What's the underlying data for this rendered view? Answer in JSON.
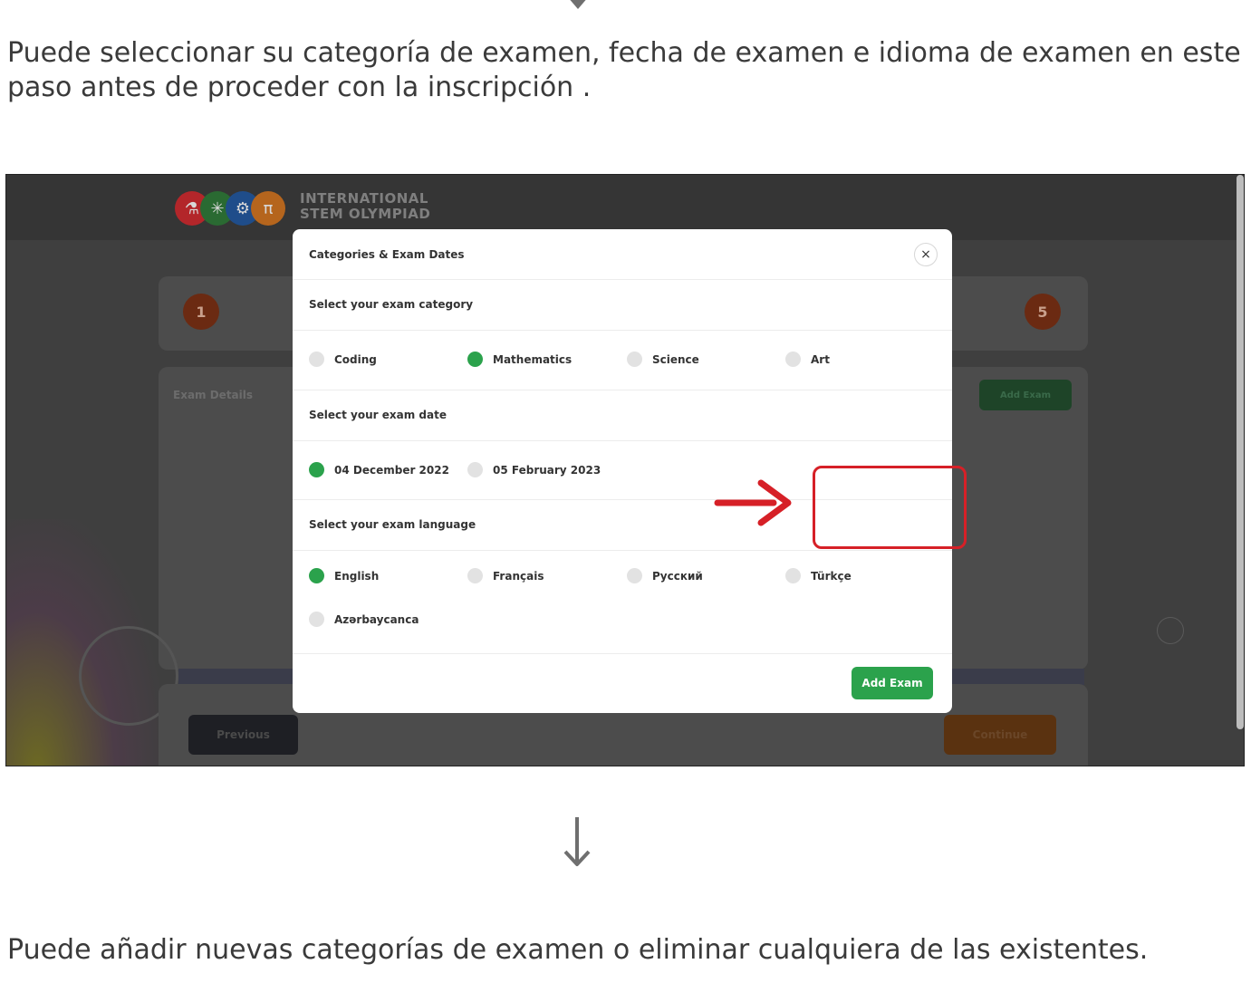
{
  "intro_text": "Puede seleccionar su categoría de examen, fecha de examen e idioma de examen en este paso antes de proceder con la inscripción .",
  "outro_text": "Puede añadir nuevas categorías de examen o eliminar cualquiera de las existentes.",
  "background": {
    "logo_line1": "INTERNATIONAL",
    "logo_line2": "STEM OLYMPIAD",
    "step_first": "1",
    "step_last": "5",
    "exam_details_label": "Exam Details",
    "add_exam_label": "Add Exam",
    "previous_label": "Previous",
    "continue_label": "Continue"
  },
  "modal": {
    "title": "Categories & Exam Dates",
    "close_glyph": "×",
    "category_title": "Select your exam category",
    "categories": [
      "Coding",
      "Mathematics",
      "Science",
      "Art"
    ],
    "category_selected": "Mathematics",
    "date_title": "Select your exam date",
    "dates": [
      "04 December 2022",
      "05 February 2023"
    ],
    "date_selected": "04 December 2022",
    "language_title": "Select your exam language",
    "languages": [
      "English",
      "Français",
      "Русский",
      "Türkçe",
      "Azərbaycanca"
    ],
    "language_selected": "English",
    "add_exam_label": "Add Exam"
  },
  "colors": {
    "accent_green": "#2ba24c",
    "highlight_red": "#d62027"
  }
}
